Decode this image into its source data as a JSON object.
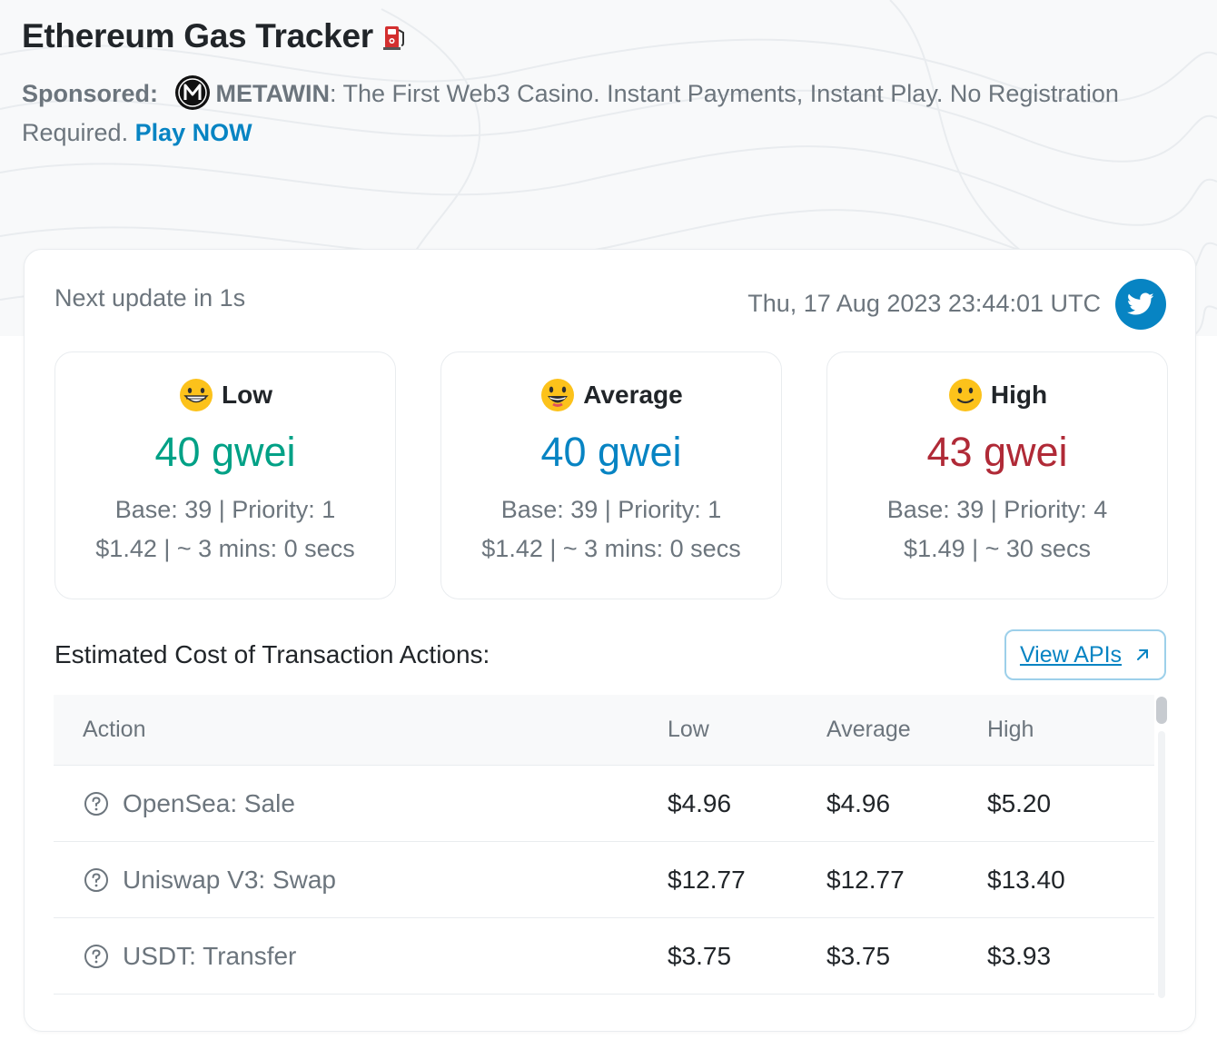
{
  "header": {
    "title": "Ethereum Gas Tracker",
    "title_icon": "fuel-pump-icon",
    "sponsor_label": "Sponsored:",
    "sponsor_brand": "METAWIN",
    "sponsor_text": ": The First Web3 Casino. Instant Payments, Instant Play. No Registration Required.",
    "sponsor_cta": "Play NOW"
  },
  "status": {
    "next_update": "Next update in 1s",
    "timestamp": "Thu, 17 Aug 2023 23:44:01 UTC",
    "share_icon": "twitter-icon"
  },
  "tiers": [
    {
      "label": "Low",
      "emoji": "grinning-face-icon",
      "gwei": "40 gwei",
      "base_priority": "Base: 39 | Priority: 1",
      "cost_time": "$1.42 | ~ 3 mins: 0 secs",
      "color": "#00a186"
    },
    {
      "label": "Average",
      "emoji": "smiling-face-icon",
      "gwei": "40 gwei",
      "base_priority": "Base: 39 | Priority: 1",
      "cost_time": "$1.42 | ~ 3 mins: 0 secs",
      "color": "#0784c3"
    },
    {
      "label": "High",
      "emoji": "slight-smile-icon",
      "gwei": "43 gwei",
      "base_priority": "Base: 39 | Priority: 4",
      "cost_time": "$1.49 | ~ 30 secs",
      "color": "#b02a37"
    }
  ],
  "actions": {
    "title": "Estimated Cost of Transaction Actions:",
    "view_apis_label": "View APIs",
    "columns": [
      "Action",
      "Low",
      "Average",
      "High"
    ],
    "rows": [
      {
        "action": "OpenSea: Sale",
        "low": "$4.96",
        "average": "$4.96",
        "high": "$5.20"
      },
      {
        "action": "Uniswap V3: Swap",
        "low": "$12.77",
        "average": "$12.77",
        "high": "$13.40"
      },
      {
        "action": "USDT: Transfer",
        "low": "$3.75",
        "average": "$3.75",
        "high": "$3.93"
      }
    ]
  }
}
